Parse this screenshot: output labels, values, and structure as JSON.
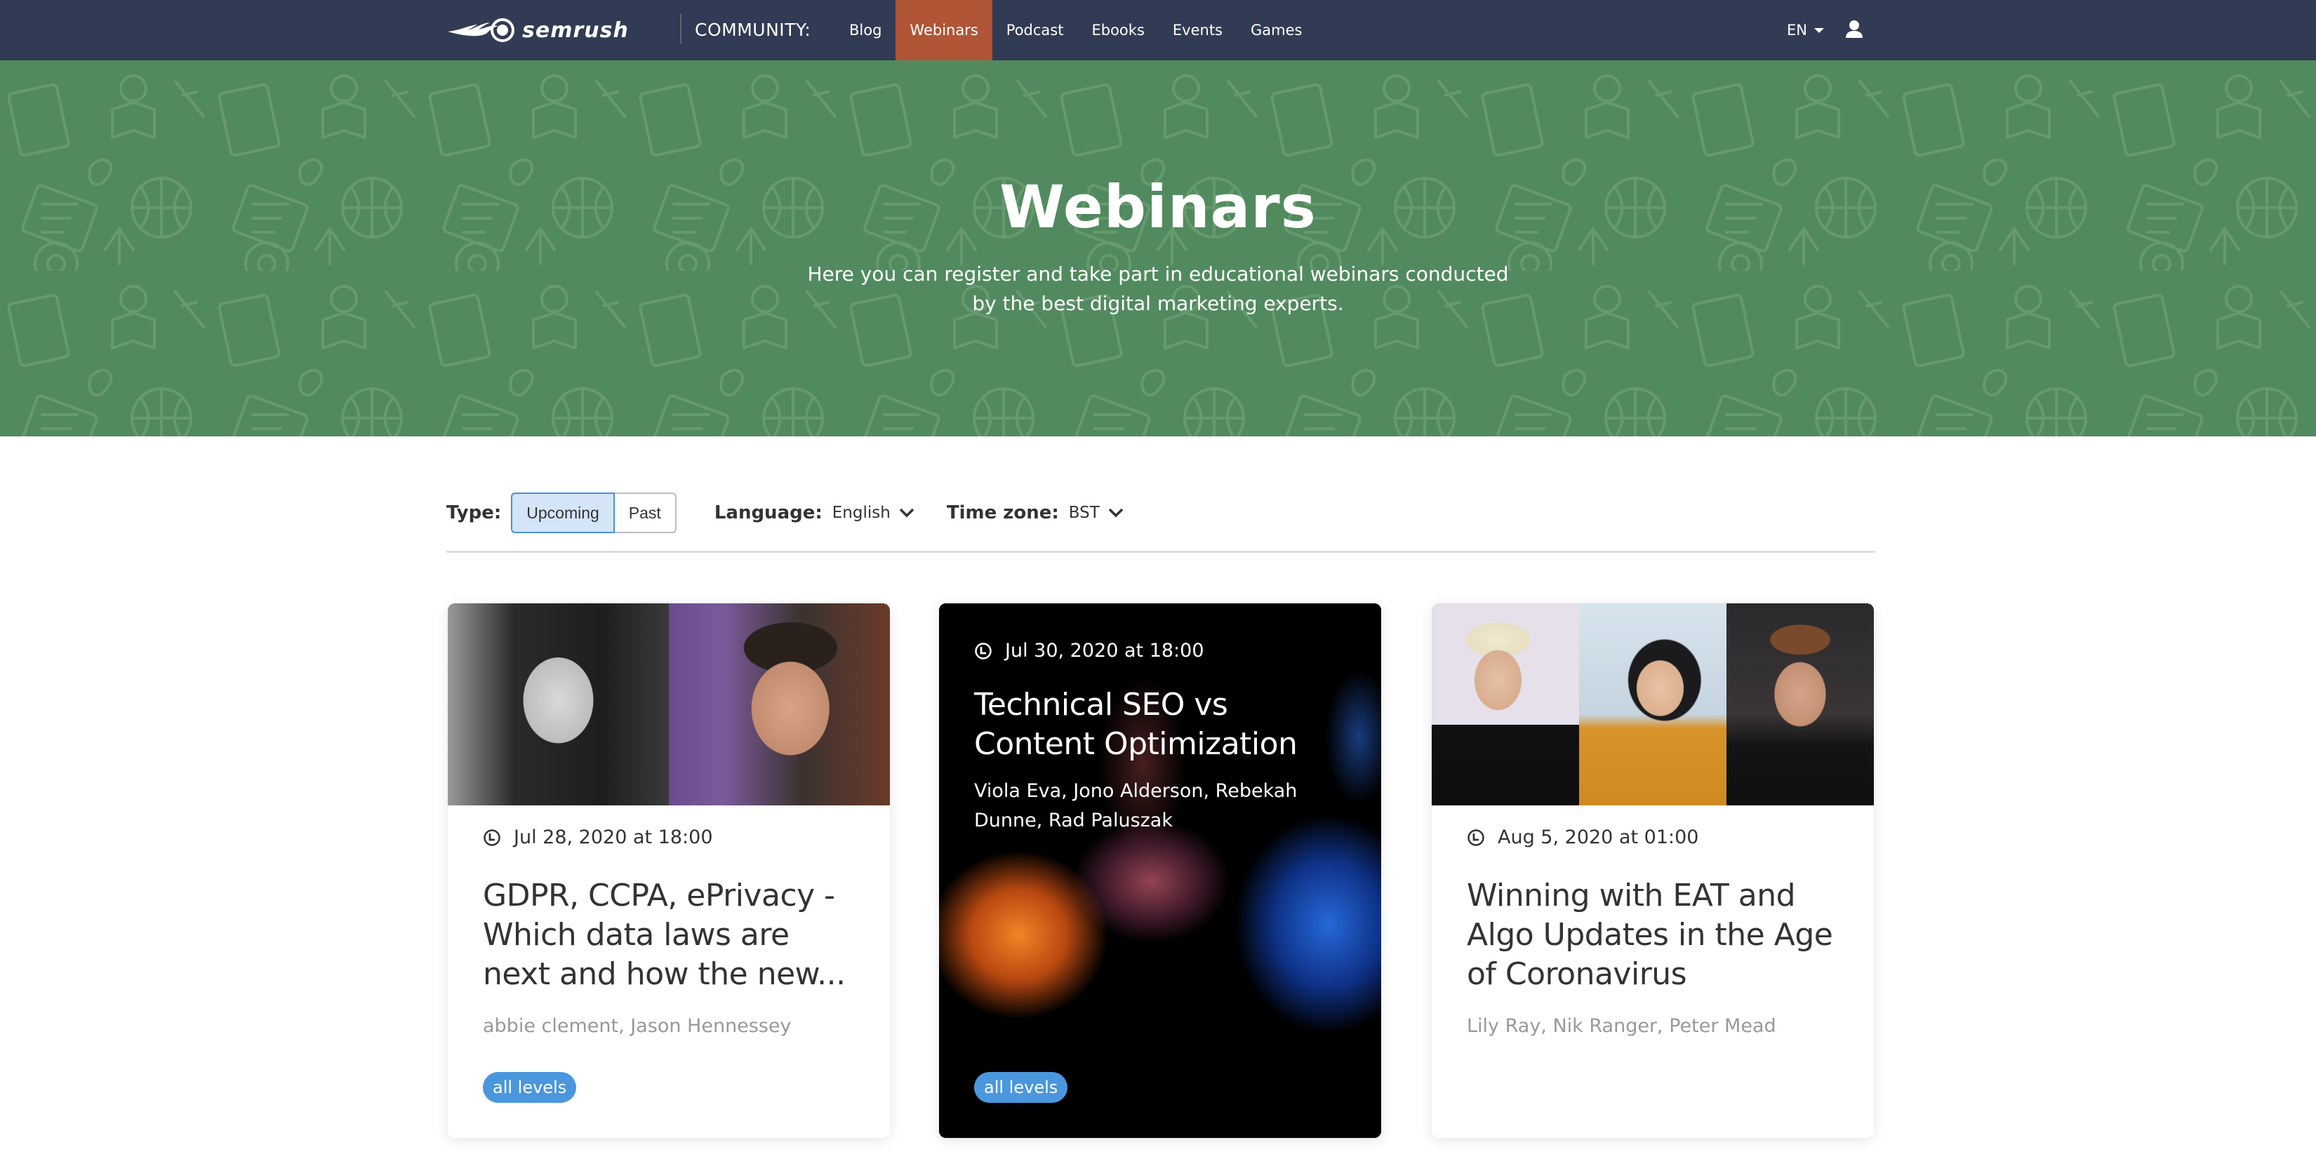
{
  "nav": {
    "brand": "semrush",
    "section_label": "COMMUNITY:",
    "items": [
      {
        "label": "Blog",
        "active": false
      },
      {
        "label": "Webinars",
        "active": true
      },
      {
        "label": "Podcast",
        "active": false
      },
      {
        "label": "Ebooks",
        "active": false
      },
      {
        "label": "Events",
        "active": false
      },
      {
        "label": "Games",
        "active": false
      }
    ],
    "language": "EN",
    "icons": {
      "language_caret": "caret-down-icon",
      "account": "user-icon"
    },
    "colors": {
      "bar": "#323b54",
      "active": "#b05536"
    }
  },
  "hero": {
    "title": "Webinars",
    "subtitle": "Here you can register and take part in educational webinars conducted by the best digital marketing experts.",
    "background_color": "#528a5f"
  },
  "filters": {
    "type_label": "Type:",
    "type_options": [
      {
        "label": "Upcoming",
        "active": true
      },
      {
        "label": "Past",
        "active": false
      }
    ],
    "language_label": "Language:",
    "language_value": "English",
    "timezone_label": "Time zone:",
    "timezone_value": "BST"
  },
  "webinars": [
    {
      "date": "Jul 28, 2020 at 18:00",
      "title": "GDPR, CCPA, ePrivacy - Which data laws are next and how the new...",
      "speakers": "abbie clement, Jason Hennessey",
      "level": "all levels",
      "image": "speaker-photos (2)"
    },
    {
      "date": "Jul 30, 2020 at 18:00",
      "title": "Technical SEO vs Content Optimization",
      "speakers": "Viola Eva, Jono Alderson, Rebekah Dunne, Rad Paluszak",
      "level": "all levels",
      "image": "fire-and-ice-background"
    },
    {
      "date": "Aug 5, 2020 at 01:00",
      "title": "Winning with EAT and Algo Updates in the Age of Coronavirus",
      "speakers": "Lily Ray, Nik Ranger, Peter Mead",
      "image": "speaker-photos (3)"
    }
  ],
  "colors": {
    "badge": "#4a97de",
    "filter_active_bg": "#d4e5f8",
    "filter_active_border": "#4a90d9"
  }
}
